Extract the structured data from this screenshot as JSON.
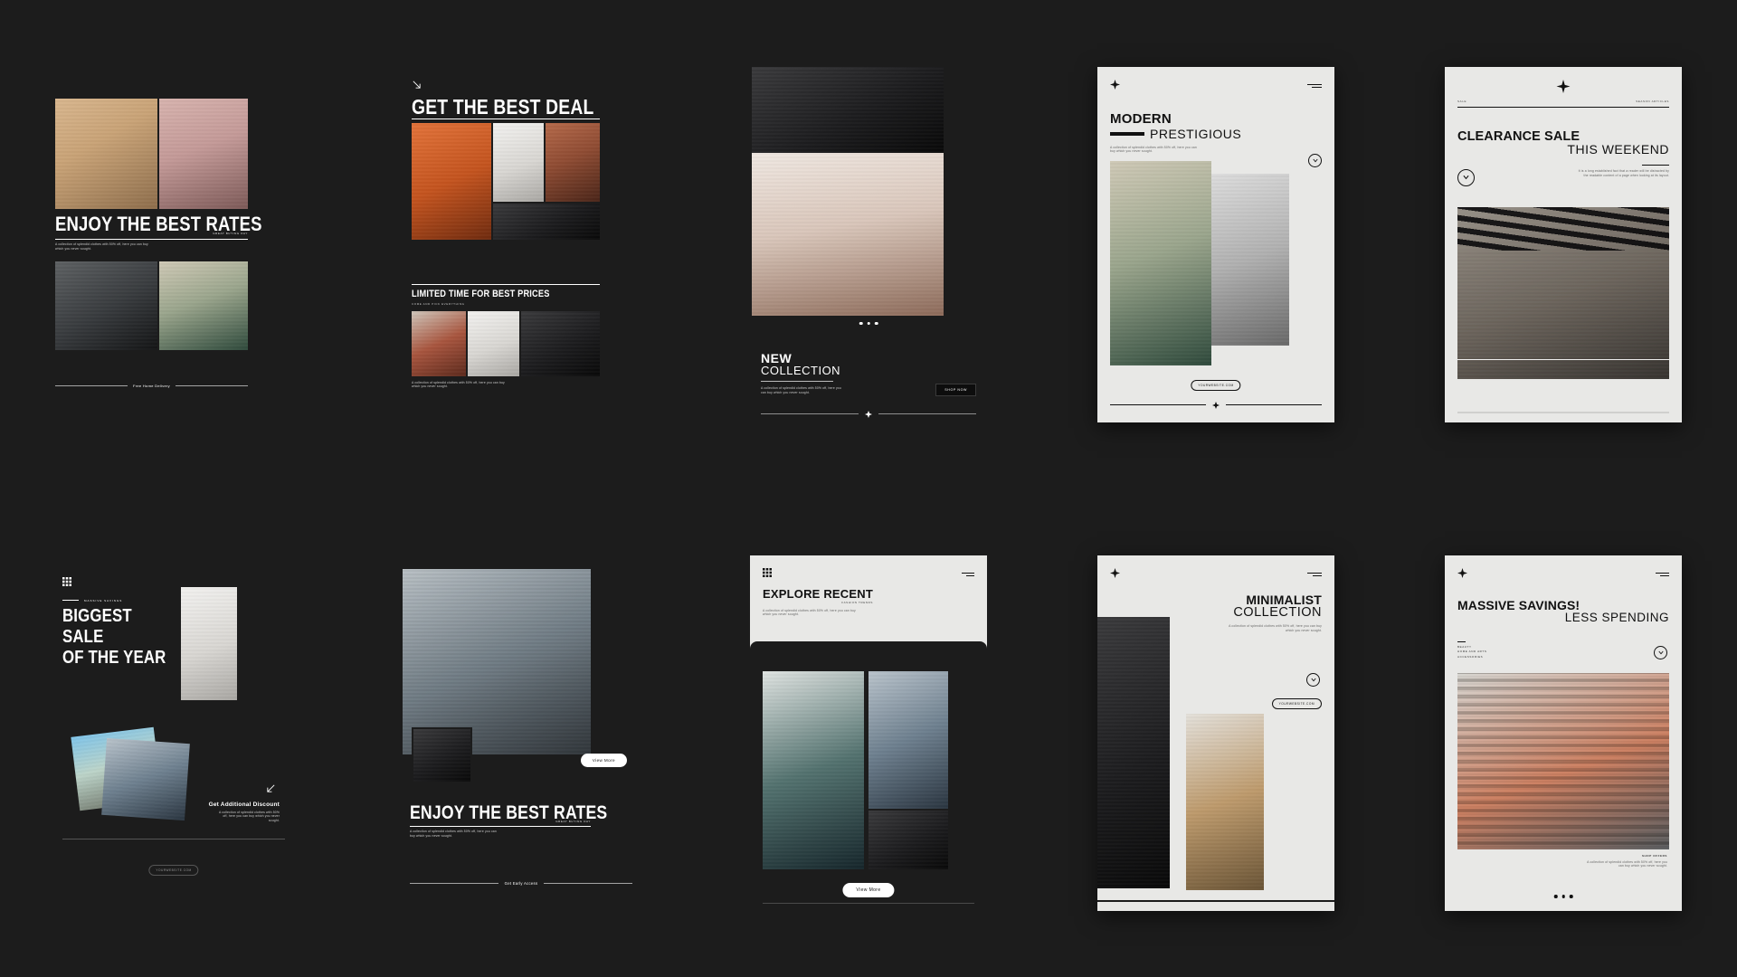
{
  "theme": {
    "bg": "#1c1c1c",
    "light_card": "#e8e8e6",
    "ink": "#111111",
    "paper": "#ffffff"
  },
  "body_copy": "A collection of splendid clothes with 50% off, here you can buy which you never sought.",
  "body_copy_alt": "It is a long established fact that a reader will be distracted by the readable content of a page when looking at its layout.",
  "cards": [
    {
      "id": "card-enjoy-best-rates",
      "style": "dark",
      "title": "ENJOY THE BEST RATES",
      "subtitle": "GREAT BUYING DAY",
      "body": "A collection of splendid clothes with 50% off, here you can buy which you never sought.",
      "footer": "Free Home Delivery"
    },
    {
      "id": "card-get-best-deal",
      "style": "dark",
      "icon": "arrow-down-right-icon",
      "title": "GET THE BEST DEAL",
      "section_title": "LIMITED TIME FOR BEST PRICES",
      "section_subtitle": "COME AND PICK EVERYTHING",
      "body": "A collection of splendid clothes with 50% off, here you can buy which you never sought."
    },
    {
      "id": "card-new-collection",
      "style": "dark",
      "title_line1": "NEW",
      "title_line2": "COLLECTION",
      "body": "A collection of splendid clothes with 50% off, here you can buy which you never sought.",
      "cta": "SHOP NOW",
      "slides": 3
    },
    {
      "id": "card-modern-prestigious",
      "style": "light",
      "icon": "sparkle-icon",
      "title_line1": "MODERN",
      "title_line2": "PRESTIGIOUS",
      "body": "A collection of splendid clothes with 50% off, here you can buy which you never sought.",
      "website": "YOURWEBSITE.COM"
    },
    {
      "id": "card-clearance-sale",
      "style": "light",
      "icon": "sparkle-icon",
      "label_left": "SALE",
      "label_right": "SEASON ARTICLES",
      "title_line1": "CLEARANCE SALE",
      "title_line2": "THIS WEEKEND",
      "body": "It is a long established fact that a reader will be distracted by the readable content of a page when looking at its layout."
    },
    {
      "id": "card-biggest-sale",
      "style": "dark",
      "icon": "grid-icon",
      "eyebrow": "MASSIVE SAVINGS",
      "title_line1": "BIGGEST",
      "title_line2": "SALE",
      "title_line3": "OF THE YEAR",
      "promo_title": "Get Additional Discount",
      "promo_body": "A collection of splendid clothes with 50% off, here you can buy which you never sought.",
      "icon_promo": "arrow-down-left-icon",
      "website": "YOURWEBSITE.COM"
    },
    {
      "id": "card-enjoy-best-rates-2",
      "style": "dark",
      "title": "ENJOY THE BEST RATES",
      "subtitle": "GREAT BUYING DAY",
      "body": "A collection of splendid clothes with 50% off, here you can buy which you never sought.",
      "cta": "View More",
      "footer": "Get Early Access"
    },
    {
      "id": "card-explore-recent",
      "style": "light",
      "icon": "grid-icon",
      "title": "EXPLORE RECENT",
      "subtitle": "FASHION TRENDS",
      "body": "A collection of splendid clothes with 50% off, here you can buy which you never sought.",
      "cta": "View More"
    },
    {
      "id": "card-minimalist-collection",
      "style": "light",
      "icon": "sparkle-icon",
      "title_line1": "MINIMALIST",
      "title_line2": "COLLECTION",
      "body": "A collection of splendid clothes with 50% off, here you can buy which you never sought.",
      "website": "YOURWEBSITE.COM"
    },
    {
      "id": "card-massive-savings",
      "style": "light",
      "icon": "sparkle-icon",
      "title_line1": "MASSIVE SAVINGS!",
      "title_line2": "LESS SPENDING",
      "menu": [
        "BEAUTY",
        "HOME AND ARTS",
        "ACCESSORIES"
      ],
      "shop_label": "SHOP OFFERS",
      "body": "A collection of splendid clothes with 50% off, here you can buy which you never sought.",
      "slides": 3
    }
  ]
}
